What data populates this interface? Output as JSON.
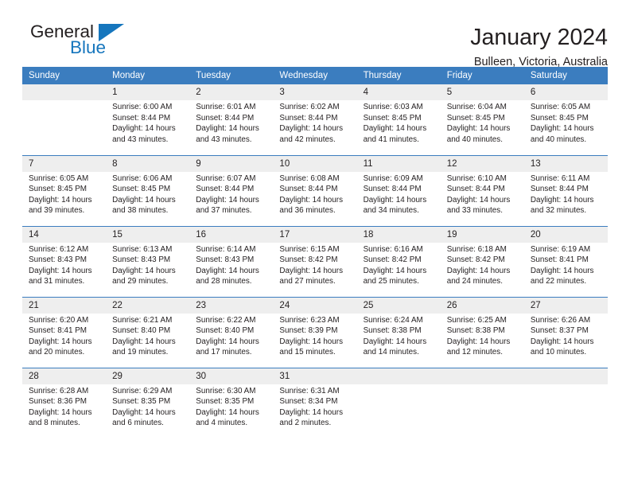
{
  "brand": {
    "name_part1": "General",
    "name_part2": "Blue",
    "accent_color": "#1676bd"
  },
  "header": {
    "title": "January 2024",
    "location": "Bulleen, Victoria, Australia"
  },
  "colors": {
    "header_row_bg": "#3b7dbf",
    "daynum_bg": "#eeeeee",
    "text": "#231f20"
  },
  "weekday_headers": [
    "Sunday",
    "Monday",
    "Tuesday",
    "Wednesday",
    "Thursday",
    "Friday",
    "Saturday"
  ],
  "weeks": [
    [
      {
        "day": "",
        "empty": true
      },
      {
        "day": "1",
        "sunrise": "Sunrise: 6:00 AM",
        "sunset": "Sunset: 8:44 PM",
        "daylight_l1": "Daylight: 14 hours",
        "daylight_l2": "and 43 minutes."
      },
      {
        "day": "2",
        "sunrise": "Sunrise: 6:01 AM",
        "sunset": "Sunset: 8:44 PM",
        "daylight_l1": "Daylight: 14 hours",
        "daylight_l2": "and 43 minutes."
      },
      {
        "day": "3",
        "sunrise": "Sunrise: 6:02 AM",
        "sunset": "Sunset: 8:44 PM",
        "daylight_l1": "Daylight: 14 hours",
        "daylight_l2": "and 42 minutes."
      },
      {
        "day": "4",
        "sunrise": "Sunrise: 6:03 AM",
        "sunset": "Sunset: 8:45 PM",
        "daylight_l1": "Daylight: 14 hours",
        "daylight_l2": "and 41 minutes."
      },
      {
        "day": "5",
        "sunrise": "Sunrise: 6:04 AM",
        "sunset": "Sunset: 8:45 PM",
        "daylight_l1": "Daylight: 14 hours",
        "daylight_l2": "and 40 minutes."
      },
      {
        "day": "6",
        "sunrise": "Sunrise: 6:05 AM",
        "sunset": "Sunset: 8:45 PM",
        "daylight_l1": "Daylight: 14 hours",
        "daylight_l2": "and 40 minutes."
      }
    ],
    [
      {
        "day": "7",
        "sunrise": "Sunrise: 6:05 AM",
        "sunset": "Sunset: 8:45 PM",
        "daylight_l1": "Daylight: 14 hours",
        "daylight_l2": "and 39 minutes."
      },
      {
        "day": "8",
        "sunrise": "Sunrise: 6:06 AM",
        "sunset": "Sunset: 8:45 PM",
        "daylight_l1": "Daylight: 14 hours",
        "daylight_l2": "and 38 minutes."
      },
      {
        "day": "9",
        "sunrise": "Sunrise: 6:07 AM",
        "sunset": "Sunset: 8:44 PM",
        "daylight_l1": "Daylight: 14 hours",
        "daylight_l2": "and 37 minutes."
      },
      {
        "day": "10",
        "sunrise": "Sunrise: 6:08 AM",
        "sunset": "Sunset: 8:44 PM",
        "daylight_l1": "Daylight: 14 hours",
        "daylight_l2": "and 36 minutes."
      },
      {
        "day": "11",
        "sunrise": "Sunrise: 6:09 AM",
        "sunset": "Sunset: 8:44 PM",
        "daylight_l1": "Daylight: 14 hours",
        "daylight_l2": "and 34 minutes."
      },
      {
        "day": "12",
        "sunrise": "Sunrise: 6:10 AM",
        "sunset": "Sunset: 8:44 PM",
        "daylight_l1": "Daylight: 14 hours",
        "daylight_l2": "and 33 minutes."
      },
      {
        "day": "13",
        "sunrise": "Sunrise: 6:11 AM",
        "sunset": "Sunset: 8:44 PM",
        "daylight_l1": "Daylight: 14 hours",
        "daylight_l2": "and 32 minutes."
      }
    ],
    [
      {
        "day": "14",
        "sunrise": "Sunrise: 6:12 AM",
        "sunset": "Sunset: 8:43 PM",
        "daylight_l1": "Daylight: 14 hours",
        "daylight_l2": "and 31 minutes."
      },
      {
        "day": "15",
        "sunrise": "Sunrise: 6:13 AM",
        "sunset": "Sunset: 8:43 PM",
        "daylight_l1": "Daylight: 14 hours",
        "daylight_l2": "and 29 minutes."
      },
      {
        "day": "16",
        "sunrise": "Sunrise: 6:14 AM",
        "sunset": "Sunset: 8:43 PM",
        "daylight_l1": "Daylight: 14 hours",
        "daylight_l2": "and 28 minutes."
      },
      {
        "day": "17",
        "sunrise": "Sunrise: 6:15 AM",
        "sunset": "Sunset: 8:42 PM",
        "daylight_l1": "Daylight: 14 hours",
        "daylight_l2": "and 27 minutes."
      },
      {
        "day": "18",
        "sunrise": "Sunrise: 6:16 AM",
        "sunset": "Sunset: 8:42 PM",
        "daylight_l1": "Daylight: 14 hours",
        "daylight_l2": "and 25 minutes."
      },
      {
        "day": "19",
        "sunrise": "Sunrise: 6:18 AM",
        "sunset": "Sunset: 8:42 PM",
        "daylight_l1": "Daylight: 14 hours",
        "daylight_l2": "and 24 minutes."
      },
      {
        "day": "20",
        "sunrise": "Sunrise: 6:19 AM",
        "sunset": "Sunset: 8:41 PM",
        "daylight_l1": "Daylight: 14 hours",
        "daylight_l2": "and 22 minutes."
      }
    ],
    [
      {
        "day": "21",
        "sunrise": "Sunrise: 6:20 AM",
        "sunset": "Sunset: 8:41 PM",
        "daylight_l1": "Daylight: 14 hours",
        "daylight_l2": "and 20 minutes."
      },
      {
        "day": "22",
        "sunrise": "Sunrise: 6:21 AM",
        "sunset": "Sunset: 8:40 PM",
        "daylight_l1": "Daylight: 14 hours",
        "daylight_l2": "and 19 minutes."
      },
      {
        "day": "23",
        "sunrise": "Sunrise: 6:22 AM",
        "sunset": "Sunset: 8:40 PM",
        "daylight_l1": "Daylight: 14 hours",
        "daylight_l2": "and 17 minutes."
      },
      {
        "day": "24",
        "sunrise": "Sunrise: 6:23 AM",
        "sunset": "Sunset: 8:39 PM",
        "daylight_l1": "Daylight: 14 hours",
        "daylight_l2": "and 15 minutes."
      },
      {
        "day": "25",
        "sunrise": "Sunrise: 6:24 AM",
        "sunset": "Sunset: 8:38 PM",
        "daylight_l1": "Daylight: 14 hours",
        "daylight_l2": "and 14 minutes."
      },
      {
        "day": "26",
        "sunrise": "Sunrise: 6:25 AM",
        "sunset": "Sunset: 8:38 PM",
        "daylight_l1": "Daylight: 14 hours",
        "daylight_l2": "and 12 minutes."
      },
      {
        "day": "27",
        "sunrise": "Sunrise: 6:26 AM",
        "sunset": "Sunset: 8:37 PM",
        "daylight_l1": "Daylight: 14 hours",
        "daylight_l2": "and 10 minutes."
      }
    ],
    [
      {
        "day": "28",
        "sunrise": "Sunrise: 6:28 AM",
        "sunset": "Sunset: 8:36 PM",
        "daylight_l1": "Daylight: 14 hours",
        "daylight_l2": "and 8 minutes."
      },
      {
        "day": "29",
        "sunrise": "Sunrise: 6:29 AM",
        "sunset": "Sunset: 8:35 PM",
        "daylight_l1": "Daylight: 14 hours",
        "daylight_l2": "and 6 minutes."
      },
      {
        "day": "30",
        "sunrise": "Sunrise: 6:30 AM",
        "sunset": "Sunset: 8:35 PM",
        "daylight_l1": "Daylight: 14 hours",
        "daylight_l2": "and 4 minutes."
      },
      {
        "day": "31",
        "sunrise": "Sunrise: 6:31 AM",
        "sunset": "Sunset: 8:34 PM",
        "daylight_l1": "Daylight: 14 hours",
        "daylight_l2": "and 2 minutes."
      },
      {
        "day": "",
        "empty": true
      },
      {
        "day": "",
        "empty": true
      },
      {
        "day": "",
        "empty": true
      }
    ]
  ]
}
